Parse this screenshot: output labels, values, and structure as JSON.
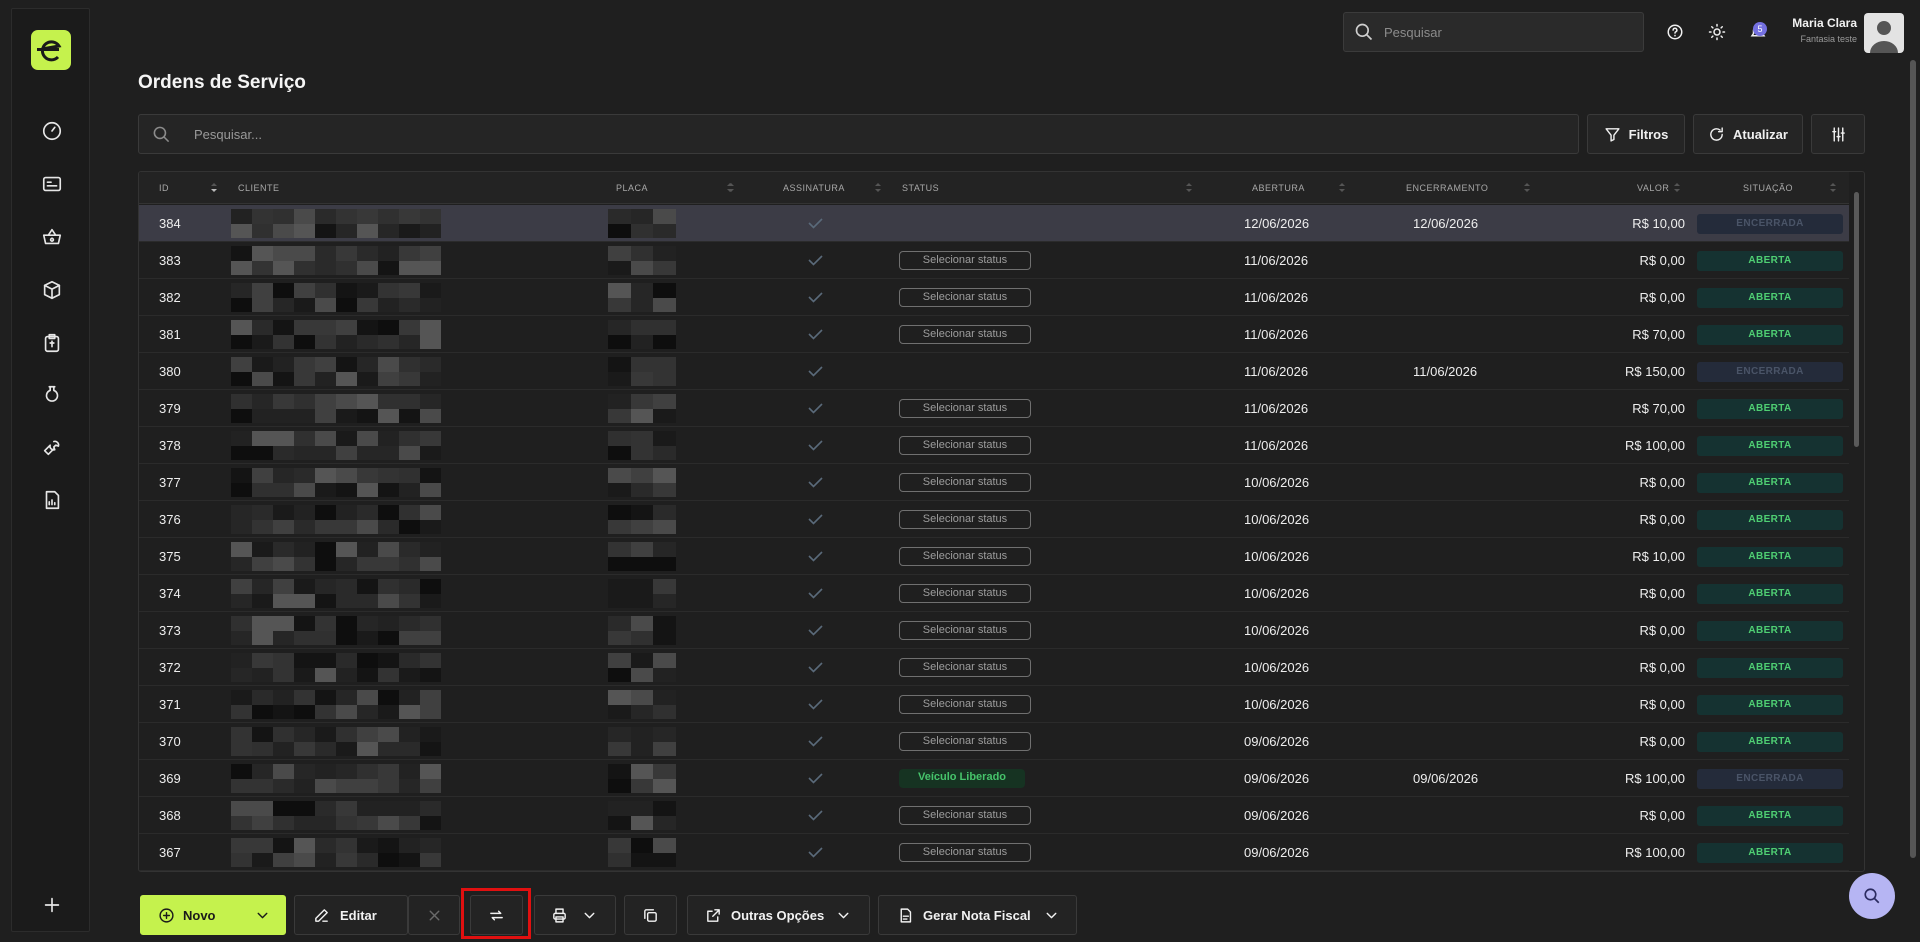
{
  "header": {
    "search_placeholder": "Pesquisar",
    "notification_count": "5",
    "user_name": "Maria Clara",
    "user_company": "Fantasia teste"
  },
  "page": {
    "title": "Ordens de Serviço",
    "search_placeholder": "Pesquisar...",
    "filters_label": "Filtros",
    "refresh_label": "Atualizar"
  },
  "sidebar": {
    "items": [
      "dashboard-icon",
      "id-card-icon",
      "basket-icon",
      "box-icon",
      "clipboard-icon",
      "bottle-icon",
      "wrench-icon",
      "report-icon",
      "plus-icon"
    ]
  },
  "table": {
    "columns": [
      "ID",
      "CLIENTE",
      "PLACA",
      "ASSINATURA",
      "STATUS",
      "ABERTURA",
      "ENCERRAMENTO",
      "VALOR",
      "SITUAÇÃO"
    ],
    "rows": [
      {
        "id": "384",
        "status": "",
        "abertura": "12/06/2026",
        "encerramento": "12/06/2026",
        "valor": "R$ 10,00",
        "situacao": "ENCERRADA"
      },
      {
        "id": "383",
        "status": "Selecionar status",
        "abertura": "11/06/2026",
        "encerramento": "",
        "valor": "R$ 0,00",
        "situacao": "ABERTA"
      },
      {
        "id": "382",
        "status": "Selecionar status",
        "abertura": "11/06/2026",
        "encerramento": "",
        "valor": "R$ 0,00",
        "situacao": "ABERTA"
      },
      {
        "id": "381",
        "status": "Selecionar status",
        "abertura": "11/06/2026",
        "encerramento": "",
        "valor": "R$ 70,00",
        "situacao": "ABERTA"
      },
      {
        "id": "380",
        "status": "",
        "abertura": "11/06/2026",
        "encerramento": "11/06/2026",
        "valor": "R$ 150,00",
        "situacao": "ENCERRADA"
      },
      {
        "id": "379",
        "status": "Selecionar status",
        "abertura": "11/06/2026",
        "encerramento": "",
        "valor": "R$ 70,00",
        "situacao": "ABERTA"
      },
      {
        "id": "378",
        "status": "Selecionar status",
        "abertura": "11/06/2026",
        "encerramento": "",
        "valor": "R$ 100,00",
        "situacao": "ABERTA"
      },
      {
        "id": "377",
        "status": "Selecionar status",
        "abertura": "10/06/2026",
        "encerramento": "",
        "valor": "R$ 0,00",
        "situacao": "ABERTA"
      },
      {
        "id": "376",
        "status": "Selecionar status",
        "abertura": "10/06/2026",
        "encerramento": "",
        "valor": "R$ 0,00",
        "situacao": "ABERTA"
      },
      {
        "id": "375",
        "status": "Selecionar status",
        "abertura": "10/06/2026",
        "encerramento": "",
        "valor": "R$ 10,00",
        "situacao": "ABERTA"
      },
      {
        "id": "374",
        "status": "Selecionar status",
        "abertura": "10/06/2026",
        "encerramento": "",
        "valor": "R$ 0,00",
        "situacao": "ABERTA"
      },
      {
        "id": "373",
        "status": "Selecionar status",
        "abertura": "10/06/2026",
        "encerramento": "",
        "valor": "R$ 0,00",
        "situacao": "ABERTA"
      },
      {
        "id": "372",
        "status": "Selecionar status",
        "abertura": "10/06/2026",
        "encerramento": "",
        "valor": "R$ 0,00",
        "situacao": "ABERTA"
      },
      {
        "id": "371",
        "status": "Selecionar status",
        "abertura": "10/06/2026",
        "encerramento": "",
        "valor": "R$ 0,00",
        "situacao": "ABERTA"
      },
      {
        "id": "370",
        "status": "Selecionar status",
        "abertura": "09/06/2026",
        "encerramento": "",
        "valor": "R$ 0,00",
        "situacao": "ABERTA"
      },
      {
        "id": "369",
        "status": "Veículo Liberado",
        "abertura": "09/06/2026",
        "encerramento": "09/06/2026",
        "valor": "R$ 100,00",
        "situacao": "ENCERRADA"
      },
      {
        "id": "368",
        "status": "Selecionar status",
        "abertura": "09/06/2026",
        "encerramento": "",
        "valor": "R$ 0,00",
        "situacao": "ABERTA"
      },
      {
        "id": "367",
        "status": "Selecionar status",
        "abertura": "09/06/2026",
        "encerramento": "",
        "valor": "R$ 100,00",
        "situacao": "ABERTA"
      }
    ]
  },
  "actions": {
    "novo": "Novo",
    "editar": "Editar",
    "outras_opcoes": "Outras Opções",
    "gerar_nota": "Gerar Nota Fiscal"
  },
  "colors": {
    "accent": "#c5f24d",
    "aberta": "#4fcf73",
    "encerrada": "#4a5467",
    "selected_row": "#3c3c46",
    "highlight": "#e01010"
  }
}
